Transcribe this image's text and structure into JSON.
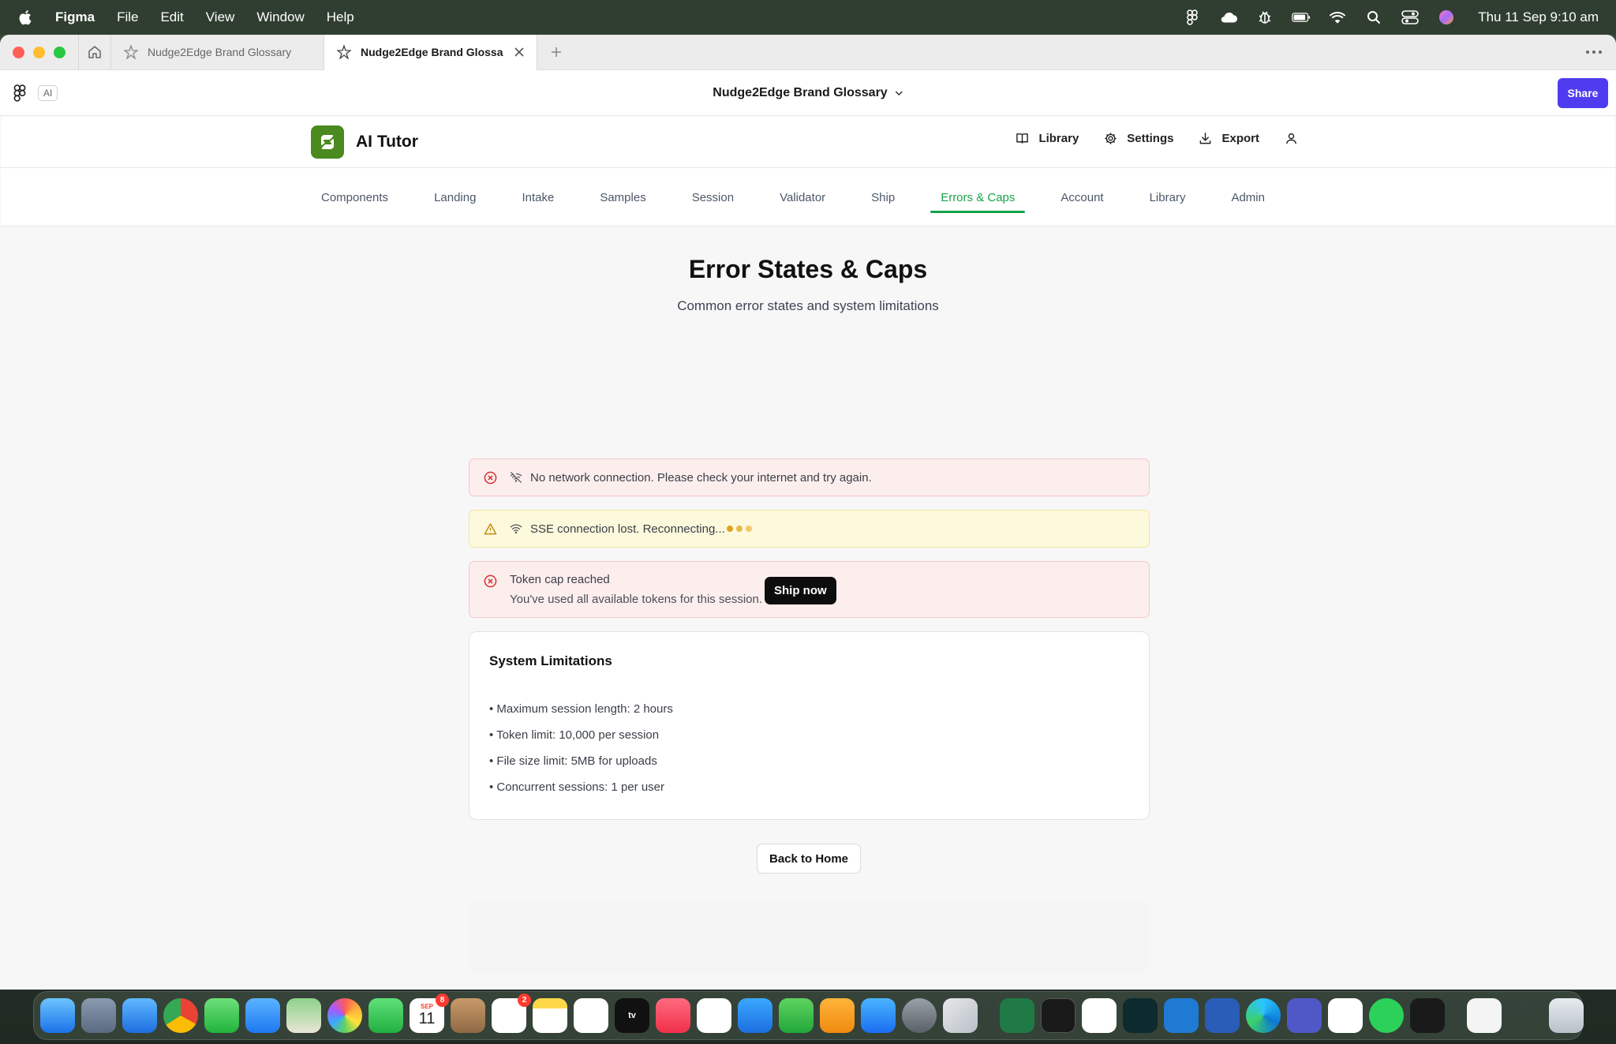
{
  "menubar": {
    "app_name": "Figma",
    "menus": [
      "File",
      "Edit",
      "View",
      "Window",
      "Help"
    ],
    "clock": "Thu 11 Sep  9:10 am"
  },
  "browser": {
    "tabs": [
      {
        "label": "Nudge2Edge Brand Glossary",
        "active": false
      },
      {
        "label": "Nudge2Edge Brand Glossary",
        "active": true
      }
    ]
  },
  "figma": {
    "ai_chip": "AI",
    "doc_title": "Nudge2Edge Brand Glossary",
    "share_label": "Share",
    "accent": "#4f3cf0"
  },
  "app": {
    "brand_name": "AI Tutor",
    "brand_color": "#4a8a1f",
    "header_actions": {
      "library": "Library",
      "settings": "Settings",
      "export": "Export"
    },
    "nav": [
      {
        "label": "Components",
        "active": false
      },
      {
        "label": "Landing",
        "active": false
      },
      {
        "label": "Intake",
        "active": false
      },
      {
        "label": "Samples",
        "active": false
      },
      {
        "label": "Session",
        "active": false
      },
      {
        "label": "Validator",
        "active": false
      },
      {
        "label": "Ship",
        "active": false
      },
      {
        "label": "Errors & Caps",
        "active": true
      },
      {
        "label": "Account",
        "active": false
      },
      {
        "label": "Library",
        "active": false
      },
      {
        "label": "Admin",
        "active": false
      }
    ],
    "active_color": "#17a34a"
  },
  "page": {
    "title": "Error States & Caps",
    "subtitle": "Common error states and system limitations",
    "alerts": {
      "network": "No network connection. Please check your internet and try again.",
      "sse": "SSE connection lost. Reconnecting...",
      "token_title": "Token cap reached",
      "token_body": "You've used all available tokens for this session.",
      "ship_now": "Ship now"
    },
    "limits": {
      "title": "System Limitations",
      "items": [
        "• Maximum session length: 2 hours",
        "• Token limit: 10,000 per session",
        "• File size limit: 5MB for uploads",
        "• Concurrent sessions: 1 per user"
      ]
    },
    "back_label": "Back to Home",
    "error_color": "#d93030",
    "warning_color": "#c08a10"
  },
  "dock": {
    "calendar_month": "SEP",
    "calendar_day": "11",
    "calendar_badge": "8",
    "reminders_badge": "2",
    "tv_label": "tv"
  }
}
